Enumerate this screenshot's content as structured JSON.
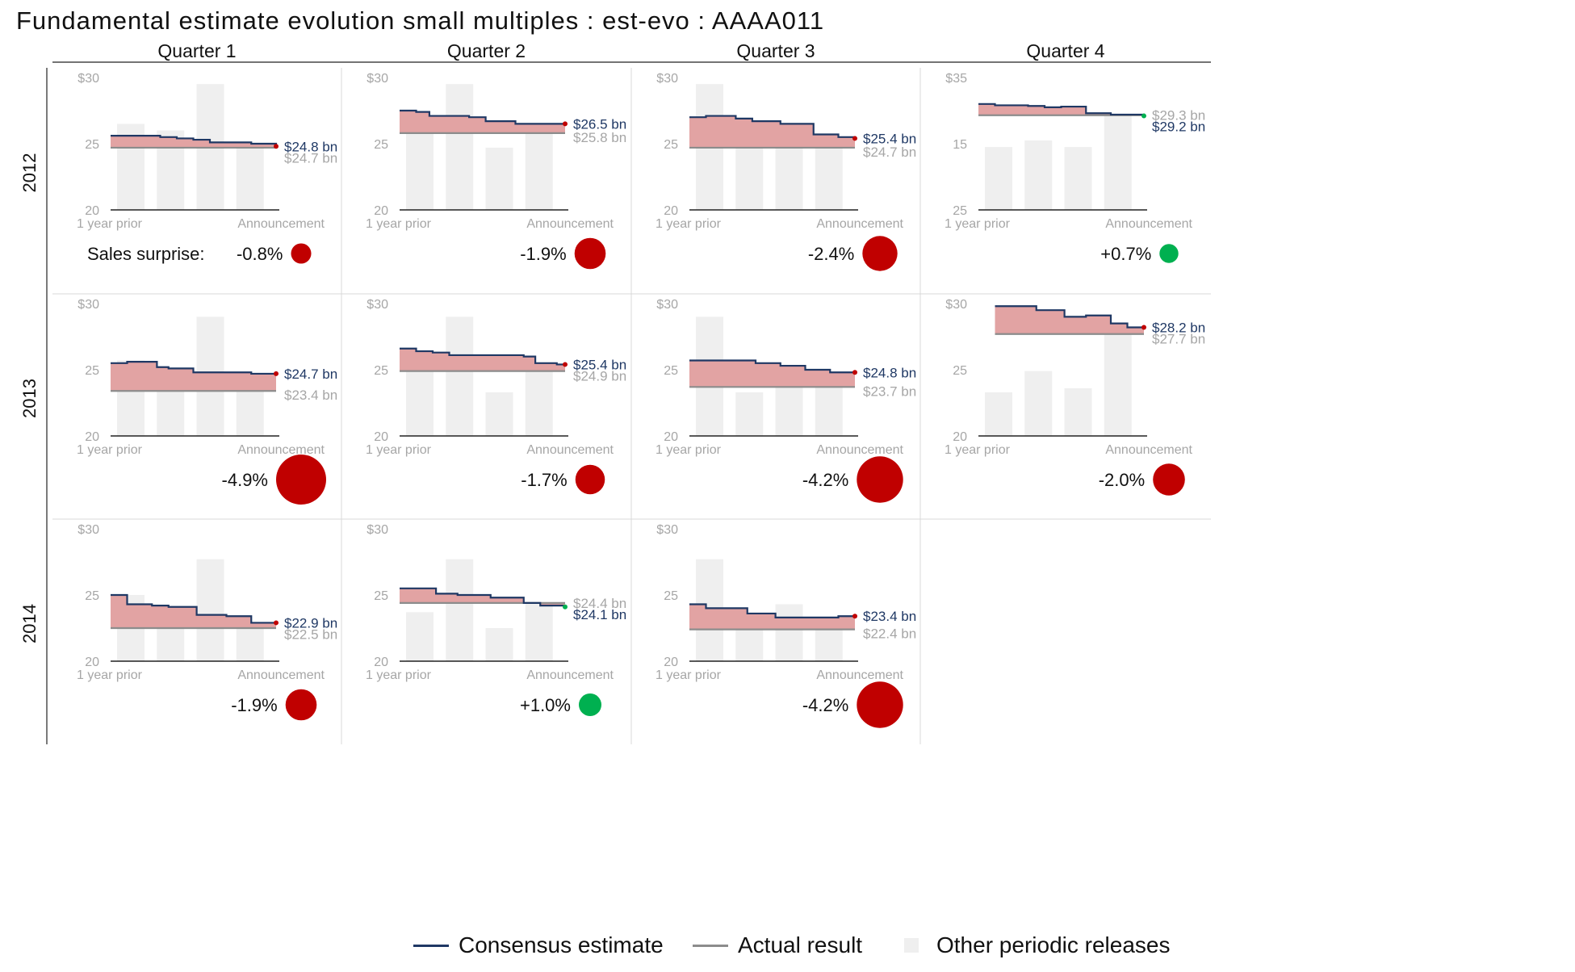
{
  "title": "Fundamental estimate evolution small multiples : est-evo : AAAA011",
  "columns": [
    "Quarter 1",
    "Quarter 2",
    "Quarter 3",
    "Quarter 4"
  ],
  "rows": [
    "2012",
    "2013",
    "2014"
  ],
  "surprise_label": "Sales surprise:",
  "x_start_label": "1 year prior",
  "x_end_label": "Announcement",
  "colors": {
    "consensus_line": "#1f3864",
    "actual_line": "#8c8c8c",
    "gap_fill": "#e2a3a3",
    "other_bars": "#efefef",
    "negative_surprise": "#c00000",
    "positive_surprise": "#00b050",
    "axis_text": "#a6a6a6",
    "consensus_text": "#1f3864"
  },
  "legend": [
    {
      "label": "Consensus estimate",
      "color": "#1f3864",
      "kind": "line"
    },
    {
      "label": "Actual result",
      "color": "#8c8c8c",
      "kind": "line"
    },
    {
      "label": "Other periodic releases",
      "color": "#efefef",
      "kind": "box"
    }
  ],
  "chart_data": [
    {
      "type": "line",
      "row": "2012",
      "column": "Quarter 1",
      "ylim": [
        20,
        30
      ],
      "y_ticks": [
        "$30",
        "25",
        "20"
      ],
      "consensus_steps": [
        [
          0,
          25.6
        ],
        [
          0.12,
          25.6
        ],
        [
          0.22,
          25.6
        ],
        [
          0.3,
          25.5
        ],
        [
          0.4,
          25.4
        ],
        [
          0.5,
          25.3
        ],
        [
          0.6,
          25.1
        ],
        [
          0.72,
          25.1
        ],
        [
          0.85,
          25.0
        ],
        [
          1.0,
          24.8
        ]
      ],
      "actual": 24.7,
      "other_releases": [
        26.5,
        26.0,
        29.5,
        24.7
      ],
      "consensus_label": "$24.8 bn",
      "actual_label": "$24.7 bn",
      "surprise": "-0.8%",
      "surprise_pct": -0.8
    },
    {
      "type": "line",
      "row": "2012",
      "column": "Quarter 2",
      "ylim": [
        20,
        30
      ],
      "y_ticks": [
        "$30",
        "25",
        "20"
      ],
      "consensus_steps": [
        [
          0,
          27.5
        ],
        [
          0.1,
          27.4
        ],
        [
          0.18,
          27.1
        ],
        [
          0.3,
          27.1
        ],
        [
          0.42,
          27.0
        ],
        [
          0.52,
          26.7
        ],
        [
          0.7,
          26.5
        ],
        [
          1.0,
          26.5
        ]
      ],
      "actual": 25.8,
      "other_releases": [
        25.8,
        29.5,
        24.7,
        25.8
      ],
      "consensus_label": "$26.5 bn",
      "actual_label": "$25.8 bn",
      "surprise": "-1.9%",
      "surprise_pct": -1.9
    },
    {
      "type": "line",
      "row": "2012",
      "column": "Quarter 3",
      "ylim": [
        20,
        30
      ],
      "y_ticks": [
        "$30",
        "25",
        "20"
      ],
      "consensus_steps": [
        [
          0,
          27.0
        ],
        [
          0.1,
          27.1
        ],
        [
          0.28,
          26.9
        ],
        [
          0.38,
          26.7
        ],
        [
          0.55,
          26.5
        ],
        [
          0.75,
          25.7
        ],
        [
          0.9,
          25.5
        ],
        [
          1.0,
          25.4
        ]
      ],
      "actual": 24.7,
      "other_releases": [
        29.5,
        24.7,
        24.7,
        24.7
      ],
      "consensus_label": "$25.4 bn",
      "actual_label": "$24.7 bn",
      "surprise": "-2.4%",
      "surprise_pct": -2.4
    },
    {
      "type": "line",
      "row": "2012",
      "column": "Quarter 4",
      "ylim": [
        15,
        35
      ],
      "y_ticks": [
        "$35",
        "15",
        "25"
      ],
      "consensus_steps": [
        [
          0,
          31.0
        ],
        [
          0.1,
          30.8
        ],
        [
          0.3,
          30.7
        ],
        [
          0.4,
          30.5
        ],
        [
          0.5,
          30.6
        ],
        [
          0.65,
          29.6
        ],
        [
          0.8,
          29.4
        ],
        [
          1.0,
          29.2
        ]
      ],
      "actual": 29.3,
      "other_releases": [
        24.5,
        25.5,
        24.5,
        29.3
      ],
      "consensus_label": "$29.2 bn",
      "actual_label": "$29.3 bn",
      "surprise": "+0.7%",
      "surprise_pct": 0.7
    },
    {
      "type": "line",
      "row": "2013",
      "column": "Quarter 1",
      "ylim": [
        20,
        30
      ],
      "y_ticks": [
        "$30",
        "25",
        "20"
      ],
      "consensus_steps": [
        [
          0,
          25.5
        ],
        [
          0.1,
          25.6
        ],
        [
          0.25,
          25.6
        ],
        [
          0.28,
          25.2
        ],
        [
          0.35,
          25.1
        ],
        [
          0.5,
          24.8
        ],
        [
          0.75,
          24.8
        ],
        [
          0.85,
          24.7
        ],
        [
          1.0,
          24.7
        ]
      ],
      "actual": 23.4,
      "other_releases": [
        25.7,
        23.4,
        29.0,
        23.4
      ],
      "consensus_label": "$24.7 bn",
      "actual_label": "$23.4 bn",
      "surprise": "-4.9%",
      "surprise_pct": -4.9
    },
    {
      "type": "line",
      "row": "2013",
      "column": "Quarter 2",
      "ylim": [
        20,
        30
      ],
      "y_ticks": [
        "$30",
        "25",
        "20"
      ],
      "consensus_steps": [
        [
          0,
          26.6
        ],
        [
          0.1,
          26.4
        ],
        [
          0.2,
          26.3
        ],
        [
          0.3,
          26.1
        ],
        [
          0.5,
          26.1
        ],
        [
          0.75,
          26.0
        ],
        [
          0.82,
          25.5
        ],
        [
          0.95,
          25.4
        ],
        [
          1.0,
          25.4
        ]
      ],
      "actual": 24.9,
      "other_releases": [
        24.9,
        29.0,
        23.3,
        24.9
      ],
      "consensus_label": "$25.4 bn",
      "actual_label": "$24.9 bn",
      "surprise": "-1.7%",
      "surprise_pct": -1.7
    },
    {
      "type": "line",
      "row": "2013",
      "column": "Quarter 3",
      "ylim": [
        20,
        30
      ],
      "y_ticks": [
        "$30",
        "25",
        "20"
      ],
      "consensus_steps": [
        [
          0,
          25.7
        ],
        [
          0.25,
          25.7
        ],
        [
          0.4,
          25.5
        ],
        [
          0.55,
          25.3
        ],
        [
          0.7,
          25.0
        ],
        [
          0.85,
          24.8
        ],
        [
          1.0,
          24.8
        ]
      ],
      "actual": 23.7,
      "other_releases": [
        29.0,
        23.3,
        23.7,
        23.7
      ],
      "consensus_label": "$24.8 bn",
      "actual_label": "$23.7 bn",
      "surprise": "-4.2%",
      "surprise_pct": -4.2
    },
    {
      "type": "line",
      "row": "2013",
      "column": "Quarter 4",
      "ylim": [
        20,
        30
      ],
      "y_ticks": [
        "$30",
        "25",
        "20"
      ],
      "consensus_steps": [
        [
          0.1,
          29.8
        ],
        [
          0.25,
          29.8
        ],
        [
          0.35,
          29.5
        ],
        [
          0.52,
          29.0
        ],
        [
          0.65,
          29.1
        ],
        [
          0.8,
          28.5
        ],
        [
          0.9,
          28.2
        ],
        [
          1.0,
          28.2
        ]
      ],
      "actual": 27.7,
      "other_releases": [
        23.3,
        24.9,
        23.6,
        27.7
      ],
      "consensus_label": "$28.2 bn",
      "actual_label": "$27.7 bn",
      "surprise": "-2.0%",
      "surprise_pct": -2.0
    },
    {
      "type": "line",
      "row": "2014",
      "column": "Quarter 1",
      "ylim": [
        20,
        30
      ],
      "y_ticks": [
        "$30",
        "25",
        "20"
      ],
      "consensus_steps": [
        [
          0,
          25.0
        ],
        [
          0.08,
          25.0
        ],
        [
          0.1,
          24.3
        ],
        [
          0.25,
          24.2
        ],
        [
          0.35,
          24.1
        ],
        [
          0.5,
          24.1
        ],
        [
          0.52,
          23.5
        ],
        [
          0.7,
          23.4
        ],
        [
          0.85,
          22.9
        ],
        [
          1.0,
          22.9
        ]
      ],
      "actual": 22.5,
      "other_releases": [
        25.0,
        22.5,
        27.7,
        22.5
      ],
      "consensus_label": "$22.9 bn",
      "actual_label": "$22.5 bn",
      "surprise": "-1.9%",
      "surprise_pct": -1.9
    },
    {
      "type": "line",
      "row": "2014",
      "column": "Quarter 2",
      "ylim": [
        20,
        30
      ],
      "y_ticks": [
        "$30",
        "25",
        "20"
      ],
      "consensus_steps": [
        [
          0,
          25.5
        ],
        [
          0.18,
          25.5
        ],
        [
          0.22,
          25.1
        ],
        [
          0.35,
          25.0
        ],
        [
          0.55,
          24.8
        ],
        [
          0.75,
          24.4
        ],
        [
          0.85,
          24.2
        ],
        [
          1.0,
          24.1
        ]
      ],
      "actual": 24.4,
      "other_releases": [
        23.7,
        27.7,
        22.5,
        24.4
      ],
      "consensus_label": "$24.1 bn",
      "actual_label": "$24.4 bn",
      "surprise": "+1.0%",
      "surprise_pct": 1.0
    },
    {
      "type": "line",
      "row": "2014",
      "column": "Quarter 3",
      "ylim": [
        20,
        30
      ],
      "y_ticks": [
        "$30",
        "25",
        "20"
      ],
      "consensus_steps": [
        [
          0,
          24.3
        ],
        [
          0.1,
          24.0
        ],
        [
          0.35,
          23.6
        ],
        [
          0.52,
          23.3
        ],
        [
          0.7,
          23.3
        ],
        [
          0.9,
          23.4
        ],
        [
          1.0,
          23.4
        ]
      ],
      "actual": 22.4,
      "other_releases": [
        27.7,
        22.4,
        24.3,
        22.4
      ],
      "consensus_label": "$23.4 bn",
      "actual_label": "$22.4 bn",
      "surprise": "-4.2%",
      "surprise_pct": -4.2
    }
  ]
}
